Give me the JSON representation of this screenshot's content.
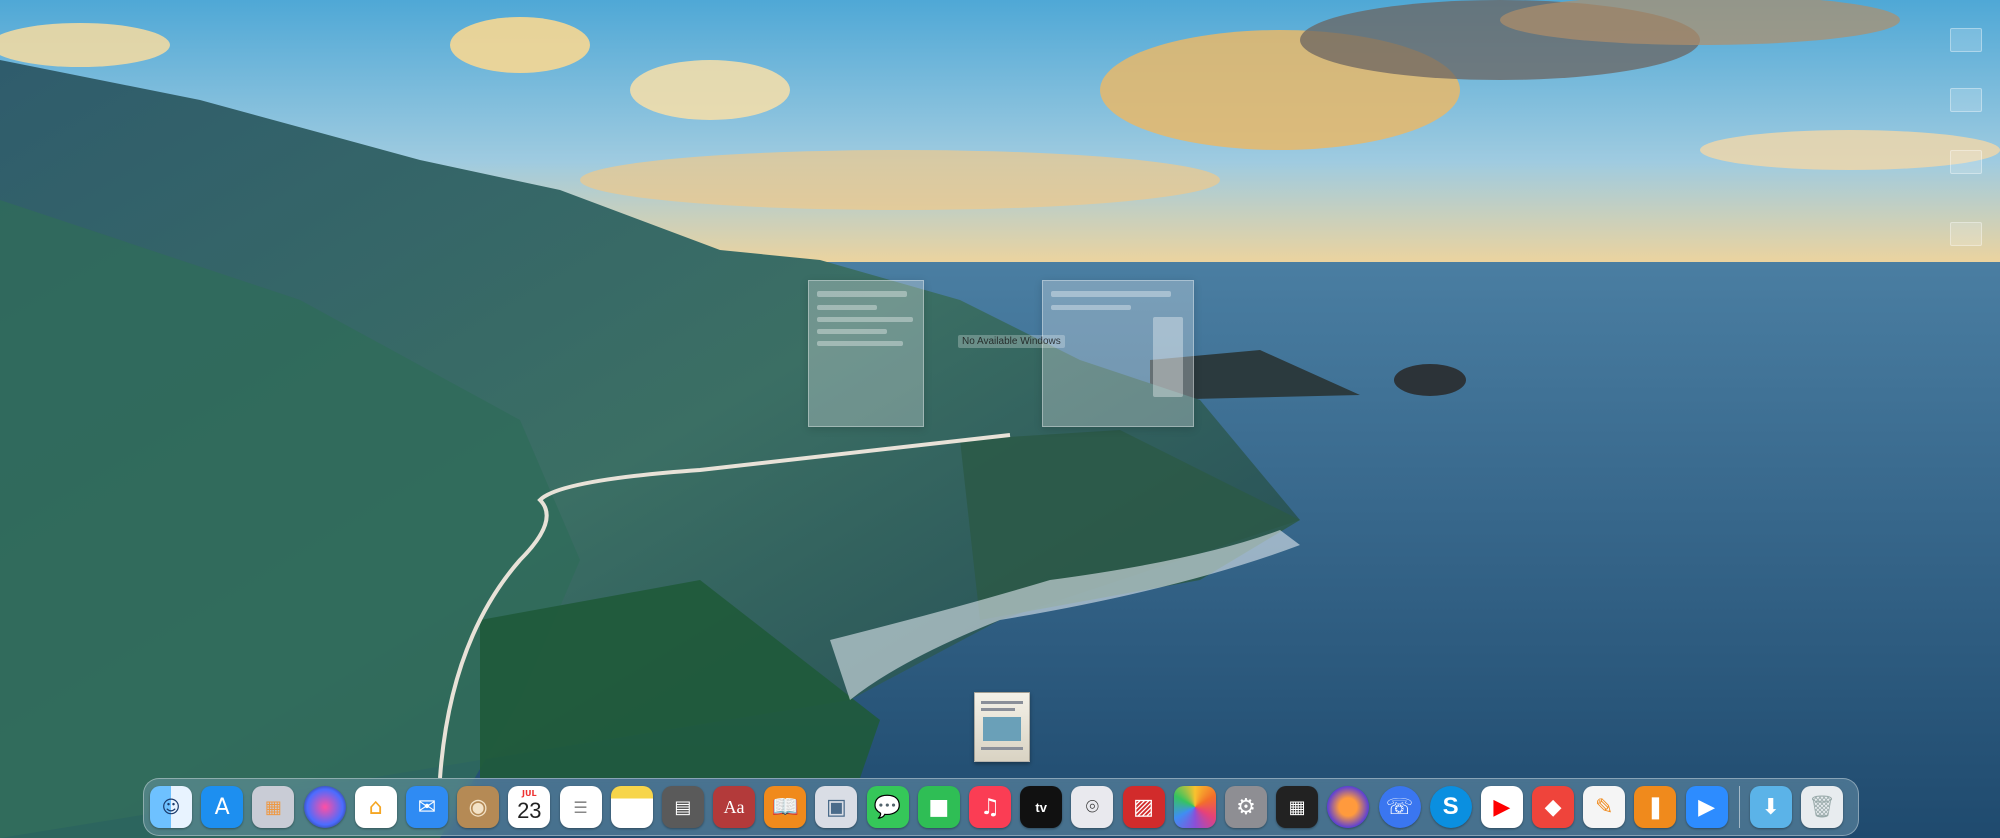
{
  "desktop": {
    "no_windows_label": "No Available Windows"
  },
  "dock": {
    "calendar": {
      "month": "JUL",
      "day": "23"
    },
    "dictionary_glyph": "Aa",
    "tv_glyph": "tv",
    "skype_glyph": "S",
    "items": [
      {
        "id": "finder",
        "icon": "finder-icon",
        "color": "#2a8df5"
      },
      {
        "id": "app-store",
        "icon": "app-store-icon",
        "color": "#1d8ff0"
      },
      {
        "id": "launchpad",
        "icon": "launchpad-icon",
        "color": "#c9ccd6"
      },
      {
        "id": "siri",
        "icon": "siri-icon",
        "color": "#3a2f6b"
      },
      {
        "id": "home",
        "icon": "home-icon",
        "color": "#f5a623"
      },
      {
        "id": "mail",
        "icon": "mail-icon",
        "color": "#2f8bf3"
      },
      {
        "id": "contacts",
        "icon": "contacts-icon",
        "color": "#b58a55"
      },
      {
        "id": "calendar",
        "icon": "calendar-icon",
        "color": "#ffffff"
      },
      {
        "id": "reminders",
        "icon": "reminders-icon",
        "color": "#ffffff"
      },
      {
        "id": "notes",
        "icon": "notes-icon",
        "color": "#f7d54a"
      },
      {
        "id": "calculator",
        "icon": "calculator-icon",
        "color": "#5a5a5a"
      },
      {
        "id": "dictionary",
        "icon": "dictionary-icon",
        "color": "#b33a3a"
      },
      {
        "id": "books",
        "icon": "books-icon",
        "color": "#f08a1c"
      },
      {
        "id": "preview",
        "icon": "preview-icon",
        "color": "#d9dde5"
      },
      {
        "id": "messages",
        "icon": "messages-icon",
        "color": "#35c759"
      },
      {
        "id": "facetime",
        "icon": "facetime-icon",
        "color": "#2fbe55"
      },
      {
        "id": "music",
        "icon": "music-icon",
        "color": "#fb3d54"
      },
      {
        "id": "apple-tv",
        "icon": "apple-tv-icon",
        "color": "#111111"
      },
      {
        "id": "screenshot",
        "icon": "screenshot-icon",
        "color": "#e9e9ee"
      },
      {
        "id": "photo-booth",
        "icon": "photo-booth-icon",
        "color": "#d22b2b"
      },
      {
        "id": "photos",
        "icon": "photos-icon",
        "color": "#ffffff"
      },
      {
        "id": "system-settings",
        "icon": "gear-icon",
        "color": "#8e8e93"
      },
      {
        "id": "mission-control",
        "icon": "mission-control-icon",
        "color": "#222222"
      },
      {
        "id": "firefox",
        "icon": "firefox-icon",
        "color": "#5b3fd6"
      },
      {
        "id": "signal",
        "icon": "signal-icon",
        "color": "#3a76f0"
      },
      {
        "id": "skype",
        "icon": "skype-icon",
        "color": "#0a8fe0"
      },
      {
        "id": "youtube",
        "icon": "youtube-icon",
        "color": "#ffffff"
      },
      {
        "id": "anydesk",
        "icon": "anydesk-icon",
        "color": "#ef443b"
      },
      {
        "id": "pages",
        "icon": "pages-icon",
        "color": "#f5f5f5"
      },
      {
        "id": "bookmark-app",
        "icon": "bookmark-icon",
        "color": "#f08a1c"
      },
      {
        "id": "zoom",
        "icon": "zoom-icon",
        "color": "#2d8cff"
      },
      {
        "id": "downloads",
        "icon": "downloads-folder-icon",
        "color": "#5bb3e8"
      },
      {
        "id": "trash",
        "icon": "trash-icon",
        "color": "#e8ecef"
      }
    ]
  }
}
